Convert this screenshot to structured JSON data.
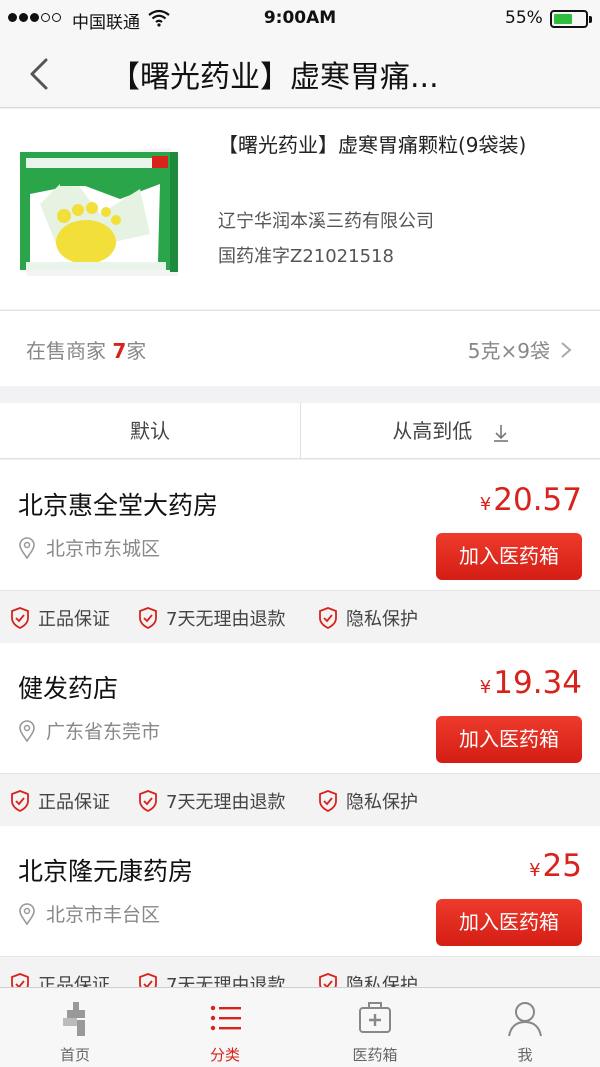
{
  "status_bar": {
    "carrier": "中国联通",
    "time": "9:00AM",
    "battery": "55%"
  },
  "nav": {
    "title": "【曙光药业】虚寒胃痛..."
  },
  "product": {
    "name": "【曙光药业】虚寒胃痛颗粒(9袋装)",
    "company": "辽宁华润本溪三药有限公司",
    "approval": "国药准字Z21021518",
    "image_icon": "medicine-box"
  },
  "sellers": {
    "prefix": "在售商家 ",
    "count": "7",
    "suffix": "家",
    "spec": "5克×9袋"
  },
  "sort": {
    "default_label": "默认",
    "price_label": "从高到低"
  },
  "stores": [
    {
      "name": "北京惠全堂大药房",
      "location": "北京市东城区",
      "currency": "¥",
      "price": "20.57",
      "add_label": "加入医药箱"
    },
    {
      "name": "健发药店",
      "location": "广东省东莞市",
      "currency": "¥",
      "price": "19.34",
      "add_label": "加入医药箱"
    },
    {
      "name": "北京隆元康药房",
      "location": "北京市丰台区",
      "currency": "¥",
      "price": "25",
      "add_label": "加入医药箱"
    }
  ],
  "guarantees": [
    "正品保证",
    "7天无理由退款",
    "隐私保护"
  ],
  "tabs": [
    {
      "label": "首页",
      "icon": "home-icon"
    },
    {
      "label": "分类",
      "icon": "category-list-icon"
    },
    {
      "label": "医药箱",
      "icon": "medicine-kit-icon"
    },
    {
      "label": "我",
      "icon": "user-icon"
    }
  ],
  "colors": {
    "accent": "#d8231c",
    "button": "#e2281e"
  }
}
